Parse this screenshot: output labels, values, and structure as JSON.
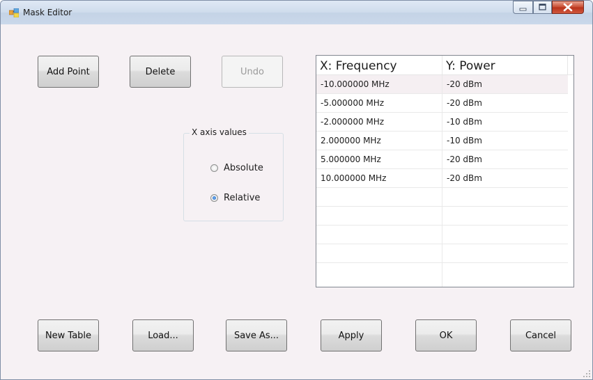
{
  "window": {
    "title": "Mask Editor",
    "app_icon": "window-app-icon",
    "accent": "#c7492e"
  },
  "caption": {
    "minimize_icon": "minimize-icon",
    "maximize_icon": "maximize-icon",
    "close_icon": "close-icon"
  },
  "toolbar": {
    "add_point": "Add Point",
    "delete": "Delete",
    "undo": "Undo"
  },
  "x_axis": {
    "legend": "X axis values",
    "options": [
      {
        "label": "Absolute",
        "checked": false
      },
      {
        "label": "Relative",
        "checked": true
      }
    ]
  },
  "table": {
    "columns": [
      "X: Frequency",
      "Y: Power"
    ],
    "rows": [
      [
        "-10.000000 MHz",
        "-20 dBm"
      ],
      [
        "-5.000000 MHz",
        "-20 dBm"
      ],
      [
        "-2.000000 MHz",
        "-10 dBm"
      ],
      [
        "2.000000 MHz",
        "-10 dBm"
      ],
      [
        "5.000000 MHz",
        "-20 dBm"
      ],
      [
        "10.000000 MHz",
        "-20 dBm"
      ],
      [
        "",
        ""
      ],
      [
        "",
        ""
      ],
      [
        "",
        ""
      ],
      [
        "",
        ""
      ],
      [
        "",
        ""
      ]
    ]
  },
  "footer": {
    "new_table": "New Table",
    "load": "Load...",
    "save_as": "Save As...",
    "apply": "Apply",
    "ok": "OK",
    "cancel": "Cancel"
  }
}
